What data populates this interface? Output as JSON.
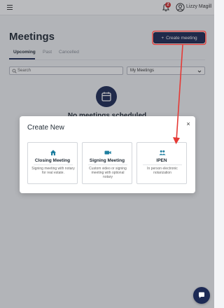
{
  "header": {
    "notification_count": "2",
    "user_name": "Lizzy Magill"
  },
  "page": {
    "title": "Meetings",
    "create_button_label": "Create meeting",
    "tabs": [
      "Upcoming",
      "Past",
      "Cancelled"
    ],
    "active_tab": "Upcoming",
    "search_placeholder": "Search",
    "filter_value": "My Meetings",
    "empty_state_title": "No meetings scheduled"
  },
  "modal": {
    "title": "Create New",
    "close_label": "×",
    "options": [
      {
        "icon": "house-icon",
        "title": "Closing Meeting",
        "description": "Signing meeting with notary for real estate."
      },
      {
        "icon": "video-camera-icon",
        "title": "Signing Meeting",
        "description": "Custom video or signing meeting with optional notary"
      },
      {
        "icon": "people-icon",
        "title": "IPEN",
        "description": "In person electronic notarization"
      }
    ]
  },
  "colors": {
    "brand_navy": "#1d2a55",
    "accent_teal": "#1f7fa0",
    "badge_red": "#d32f2f",
    "annotation_red": "#e53935"
  }
}
